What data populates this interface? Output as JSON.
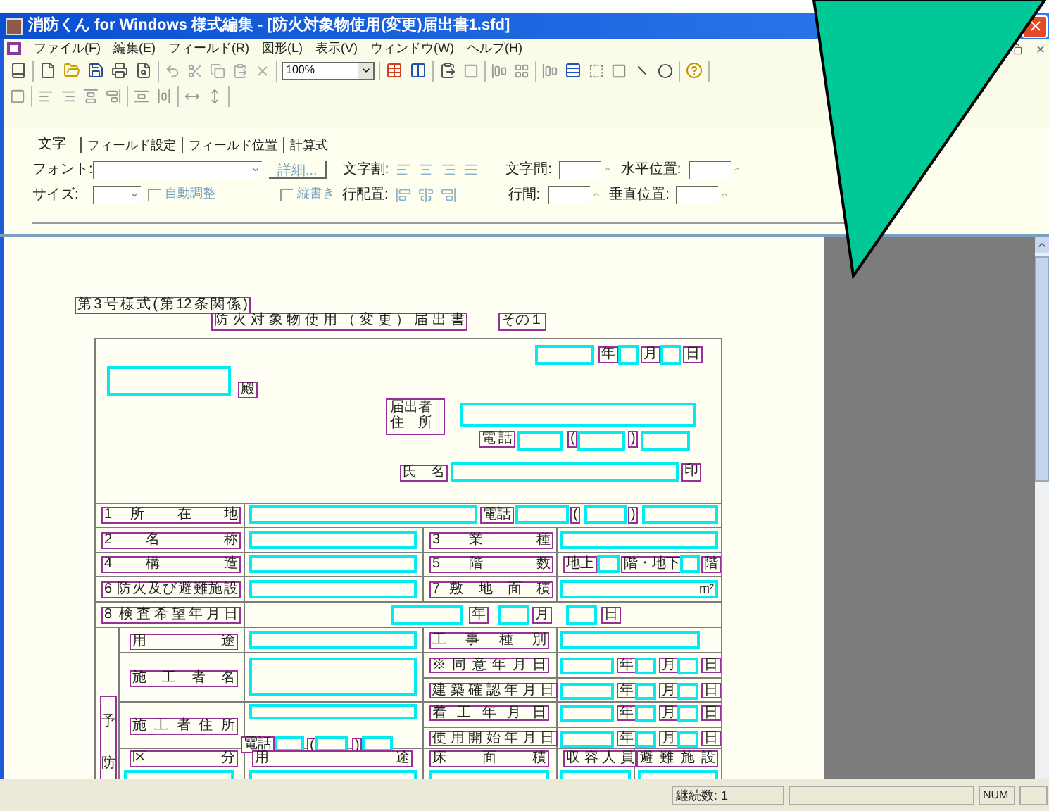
{
  "window": {
    "title": "消防くん for Windows 様式編集 - [防火対象物使用(変更)届出書1.sfd]"
  },
  "menu": [
    "ファイル(F)",
    "編集(E)",
    "フィールド(R)",
    "図形(L)",
    "表示(V)",
    "ウィンドウ(W)",
    "ヘルプ(H)"
  ],
  "toolbar": {
    "zoom": "100%"
  },
  "properties": {
    "tabs": [
      {
        "label": "文字",
        "selected": true
      },
      {
        "label": "フィールド設定",
        "selected": false
      },
      {
        "label": "フィールド位置",
        "selected": false
      },
      {
        "label": "計算式",
        "selected": false
      }
    ],
    "font_label": "フォント:",
    "detail_button": {
      "label": "詳細...",
      "disabled": true
    },
    "char_align_label": "文字割:",
    "char_spacing_label": "文字間:",
    "h_pos_label": "水平位置:",
    "size_label": "サイズ:",
    "auto_fit": {
      "label": "自動調整",
      "checked": false,
      "disabled": true
    },
    "vertical": {
      "label": "縦書き",
      "checked": false,
      "disabled": true
    },
    "line_align_label": "行配置:",
    "line_spacing_label": "行間:",
    "v_pos_label": "垂直位置:"
  },
  "form": {
    "items": [
      {
        "kind": "label",
        "text": "第3号様式(第12条関係)"
      },
      {
        "kind": "label",
        "text": "防 火 対 象 物 使 用 （ 変 更 ） 届 出 書"
      },
      {
        "kind": "label",
        "text": "その１"
      },
      {
        "kind": "field"
      },
      {
        "kind": "label",
        "text": "年"
      },
      {
        "kind": "field"
      },
      {
        "kind": "label",
        "text": "月"
      },
      {
        "kind": "field"
      },
      {
        "kind": "label",
        "text": "日"
      },
      {
        "kind": "field"
      },
      {
        "kind": "label",
        "text": "殿"
      },
      {
        "kind": "label",
        "lines": [
          "届出者",
          "住　所"
        ]
      },
      {
        "kind": "field"
      },
      {
        "kind": "label",
        "text": "電話"
      },
      {
        "kind": "field"
      },
      {
        "kind": "label",
        "text": "("
      },
      {
        "kind": "field"
      },
      {
        "kind": "label",
        "text": ")"
      },
      {
        "kind": "field"
      },
      {
        "kind": "label",
        "text": "氏 名"
      },
      {
        "kind": "field"
      },
      {
        "kind": "label",
        "text": "印"
      },
      {
        "kind": "label",
        "text": "1 所 在 地"
      },
      {
        "kind": "field"
      },
      {
        "kind": "label",
        "text": "電話"
      },
      {
        "kind": "field"
      },
      {
        "kind": "label",
        "text": "("
      },
      {
        "kind": "field"
      },
      {
        "kind": "label",
        "text": ")"
      },
      {
        "kind": "field"
      },
      {
        "kind": "label",
        "text": "2 名 称"
      },
      {
        "kind": "field"
      },
      {
        "kind": "label",
        "text": "3 業 種"
      },
      {
        "kind": "field"
      },
      {
        "kind": "label",
        "text": "4 構 造"
      },
      {
        "kind": "field"
      },
      {
        "kind": "label",
        "text": "5 階 数"
      },
      {
        "kind": "label",
        "text": "地上"
      },
      {
        "kind": "field"
      },
      {
        "kind": "label",
        "text": "階・地下"
      },
      {
        "kind": "field"
      },
      {
        "kind": "label",
        "text": "階"
      },
      {
        "kind": "label",
        "text": "6 防火及び避難施設"
      },
      {
        "kind": "field"
      },
      {
        "kind": "label",
        "text": "7 敷 地 面 積"
      },
      {
        "kind": "field",
        "unit": "m²"
      },
      {
        "kind": "label",
        "text": "8 検査希望年月日"
      },
      {
        "kind": "field"
      },
      {
        "kind": "label",
        "text": "年"
      },
      {
        "kind": "field"
      },
      {
        "kind": "label",
        "text": "月"
      },
      {
        "kind": "field"
      },
      {
        "kind": "label",
        "text": "日"
      },
      {
        "kind": "vlabel",
        "text": "予防"
      },
      {
        "kind": "label",
        "text": "用 途"
      },
      {
        "kind": "field"
      },
      {
        "kind": "label",
        "text": "工 事 種 別"
      },
      {
        "kind": "field"
      },
      {
        "kind": "label",
        "text": "施 工 者 名"
      },
      {
        "kind": "field"
      },
      {
        "kind": "label",
        "text": "※ 同 意 年 月 日"
      },
      {
        "kind": "field"
      },
      {
        "kind": "label",
        "text": "年"
      },
      {
        "kind": "field"
      },
      {
        "kind": "label",
        "text": "月"
      },
      {
        "kind": "field"
      },
      {
        "kind": "label",
        "text": "日"
      },
      {
        "kind": "label",
        "text": "建 築 確 認 年 月 日"
      },
      {
        "kind": "field"
      },
      {
        "kind": "label",
        "text": "年"
      },
      {
        "kind": "field"
      },
      {
        "kind": "label",
        "text": "月"
      },
      {
        "kind": "field"
      },
      {
        "kind": "label",
        "text": "日"
      },
      {
        "kind": "label",
        "text": "施 工 者 住 所"
      },
      {
        "kind": "field"
      },
      {
        "kind": "label",
        "text": "電話"
      },
      {
        "kind": "field"
      },
      {
        "kind": "label",
        "text": "("
      },
      {
        "kind": "field"
      },
      {
        "kind": "label",
        "text": ")"
      },
      {
        "kind": "field"
      },
      {
        "kind": "label",
        "text": "着 工 年 月 日"
      },
      {
        "kind": "field"
      },
      {
        "kind": "label",
        "text": "年"
      },
      {
        "kind": "field"
      },
      {
        "kind": "label",
        "text": "月"
      },
      {
        "kind": "field"
      },
      {
        "kind": "label",
        "text": "日"
      },
      {
        "kind": "label",
        "text": "使 用 開 始 年 月 日"
      },
      {
        "kind": "field"
      },
      {
        "kind": "label",
        "text": "年"
      },
      {
        "kind": "field"
      },
      {
        "kind": "label",
        "text": "月"
      },
      {
        "kind": "field"
      },
      {
        "kind": "label",
        "text": "日"
      },
      {
        "kind": "label",
        "text": "区 分"
      },
      {
        "kind": "label",
        "text": "用 途"
      },
      {
        "kind": "label",
        "text": "床 面 積"
      },
      {
        "kind": "label",
        "text": "収 容 人 員"
      },
      {
        "kind": "label",
        "text": "避 難 施 設"
      },
      {
        "kind": "field"
      },
      {
        "kind": "field"
      },
      {
        "kind": "field"
      },
      {
        "kind": "field"
      },
      {
        "kind": "field"
      }
    ]
  },
  "status_bar": {
    "count": "継続数: 1",
    "num": "NUM"
  }
}
